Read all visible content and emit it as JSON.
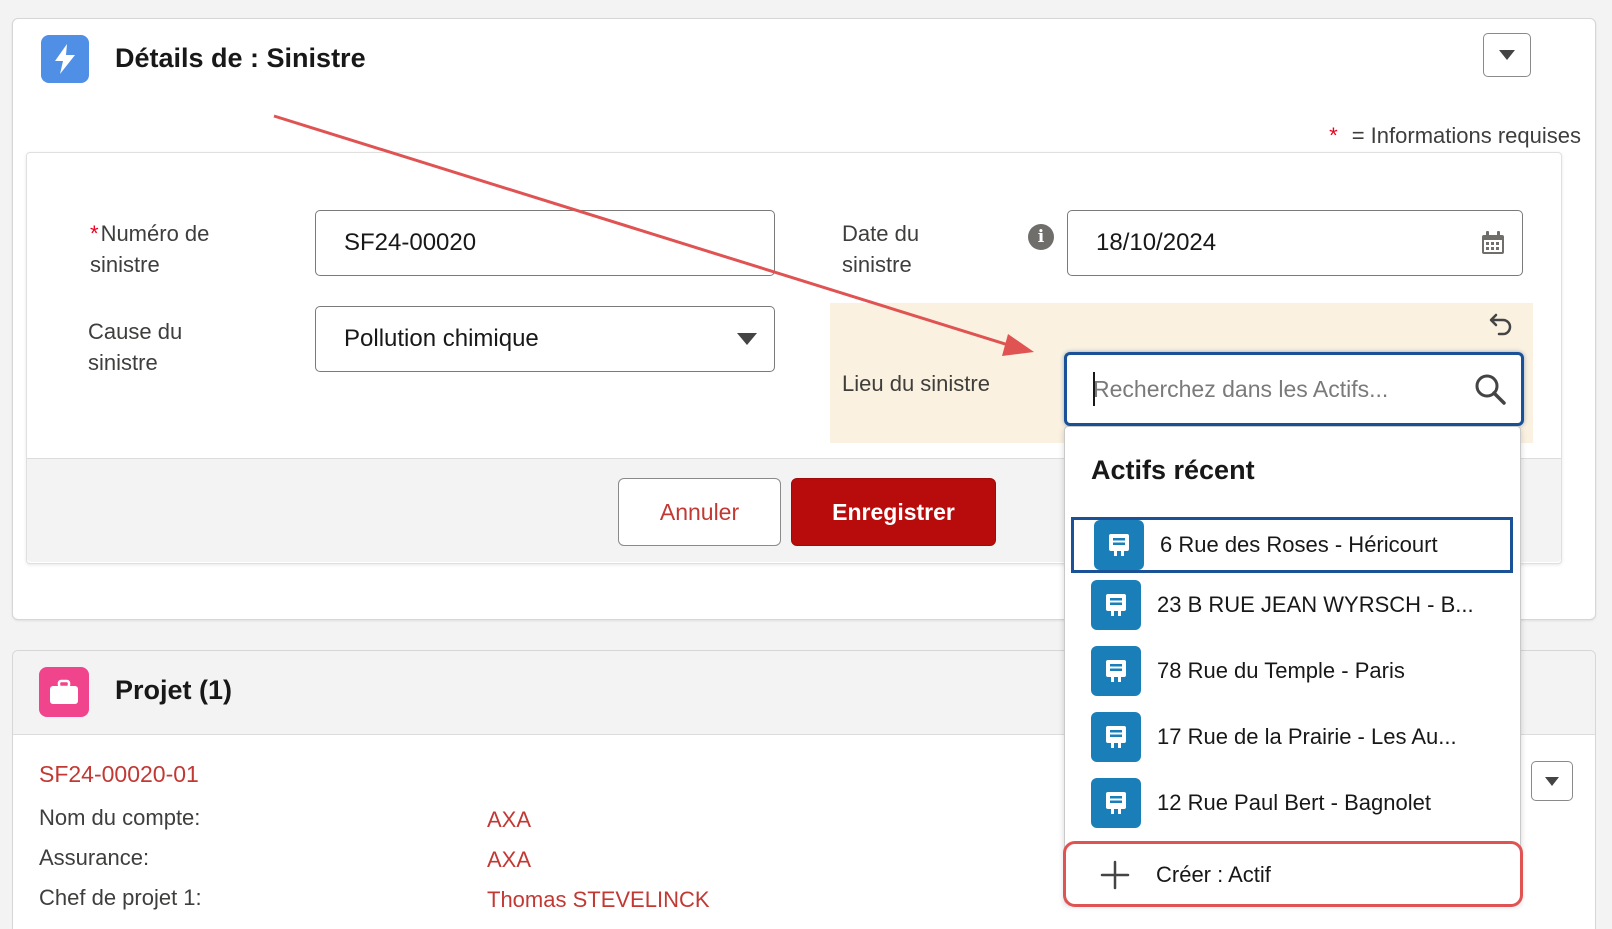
{
  "details_card": {
    "title": "Détails de : Sinistre",
    "required_star": "*",
    "required_note": "= Informations requises",
    "fields": {
      "numero": {
        "required_star": "*",
        "label_line1": "Numéro de",
        "label_line2": "sinistre",
        "value": "SF24-00020"
      },
      "cause": {
        "label_line1": "Cause du",
        "label_line2": "sinistre",
        "value": "Pollution chimique"
      },
      "date": {
        "label_line1": "Date du",
        "label_line2": "sinistre",
        "value": "18/10/2024",
        "info_glyph": "i"
      },
      "lieu": {
        "label": "Lieu du sinistre",
        "placeholder": "Recherchez dans les Actifs..."
      }
    },
    "buttons": {
      "cancel": "Annuler",
      "save": "Enregistrer"
    }
  },
  "dropdown": {
    "header": "Actifs récent",
    "items": [
      {
        "label": "6 Rue des Roses - Héricourt",
        "selected": true
      },
      {
        "label": "23 B RUE JEAN WYRSCH - B...",
        "selected": false
      },
      {
        "label": "78 Rue du Temple - Paris",
        "selected": false
      },
      {
        "label": "17 Rue de la Prairie - Les Au...",
        "selected": false
      },
      {
        "label": "12 Rue Paul Bert - Bagnolet",
        "selected": false
      }
    ],
    "create_label": "Créer : Actif"
  },
  "project_card": {
    "title": "Projet (1)",
    "record_link": "SF24-00020-01",
    "rows": [
      {
        "label": "Nom du compte:",
        "value": "AXA"
      },
      {
        "label": "Assurance:",
        "value": "AXA"
      },
      {
        "label": "Chef de projet 1:",
        "value": "Thomas STEVELINCK"
      }
    ]
  },
  "colors": {
    "brand_red": "#b80c0c",
    "link_red": "#c23934",
    "focus_blue": "#1b5297",
    "asset_blue": "#1a7fb9",
    "annotation_red": "#e05353",
    "highlight_bg": "#faf1e0"
  },
  "icons": {
    "details": "lightning-bolt-icon",
    "project": "briefcase-icon",
    "calendar": "calendar-icon",
    "search": "search-icon",
    "undo": "undo-icon",
    "asset": "asset-icon",
    "create": "plus-icon"
  }
}
